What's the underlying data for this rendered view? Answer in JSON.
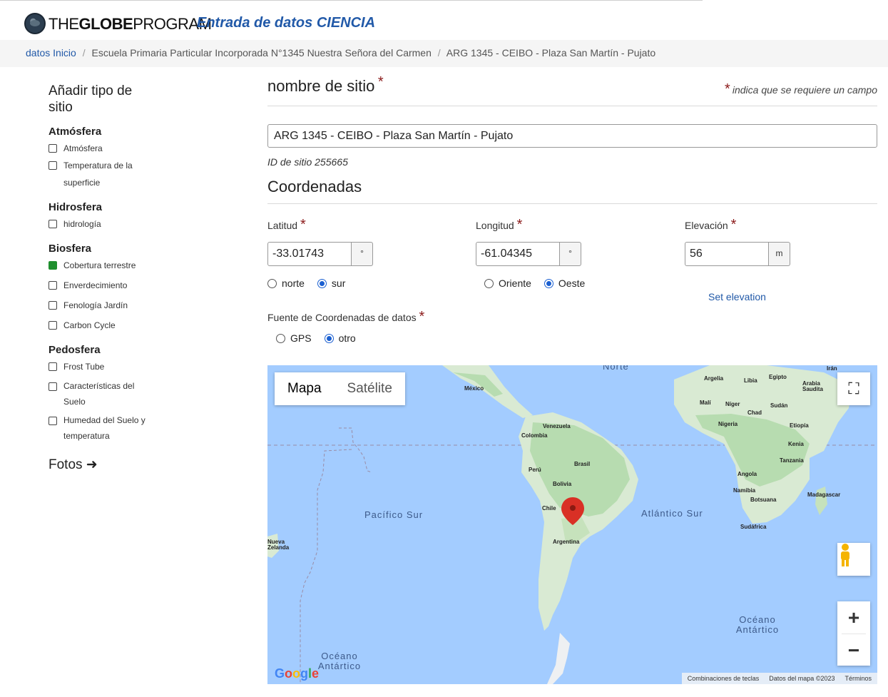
{
  "header": {
    "brand_the": "THE",
    "brand_globe": "GLOBE",
    "brand_program": "PROGRAM",
    "app_title": "Entrada de datos CIENCIA"
  },
  "breadcrumb": {
    "home": "datos Inicio",
    "school": "Escuela Primaria Particular Incorporada N°1345 Nuestra Señora del Carmen",
    "site": "ARG 1345 - CEIBO - Plaza San Martín - Pujato",
    "separator": "/"
  },
  "sidebar": {
    "title": "Añadir tipo de sitio",
    "groups": [
      {
        "name": "Atmósfera",
        "items": [
          "Atmósfera",
          "Temperatura de la superficie"
        ]
      },
      {
        "name": "Hidrosfera",
        "items": [
          "hidrología"
        ]
      },
      {
        "name": "Biosfera",
        "items": [
          "Cobertura terrestre",
          "Enverdecimiento",
          "Fenología Jardín",
          "Carbon Cycle"
        ]
      },
      {
        "name": "Pedosfera",
        "items": [
          "Frost Tube",
          "Características del Suelo",
          "Humedad del Suelo y temperatura"
        ]
      }
    ],
    "fotos": "Fotos ➜"
  },
  "form": {
    "site_name_heading": "nombre de sitio",
    "required_star": "*",
    "required_note": "indica que se requiere un campo",
    "site_name_value": "ARG 1345 - CEIBO - Plaza San Martín - Pujato",
    "site_id": "ID de sitio 255665",
    "coords_heading": "Coordenadas",
    "latitude": {
      "label": "Latitud",
      "value": "-33.01743",
      "unit": "°",
      "options": [
        "norte",
        "sur"
      ],
      "selected": "sur"
    },
    "longitude": {
      "label": "Longitud",
      "value": "-61.04345",
      "unit": "°",
      "options": [
        "Oriente",
        "Oeste"
      ],
      "selected": "Oeste"
    },
    "elevation": {
      "label": "Elevación",
      "value": "56",
      "unit": "m",
      "action": "Set elevation"
    },
    "source": {
      "label": "Fuente de Coordenadas de datos",
      "options": [
        "GPS",
        "otro"
      ],
      "selected": "otro"
    }
  },
  "map": {
    "type_buttons": [
      "Mapa",
      "Satélite"
    ],
    "active_type": "Mapa",
    "ocean_labels": [
      "Pacífico Sur",
      "Atlántico Sur",
      "Océano Antártico",
      "Océano Antártico",
      "Norte"
    ],
    "countries": [
      "México",
      "Venezuela",
      "Colombia",
      "Perú",
      "Brasil",
      "Bolivia",
      "Chile",
      "Argentina",
      "Argelia",
      "Libia",
      "Egipto",
      "Arabia Saudita",
      "Malí",
      "Níger",
      "Chad",
      "Sudán",
      "Nigeria",
      "Etiopía",
      "Kenia",
      "Tanzania",
      "Angola",
      "Namibia",
      "Botsuana",
      "Madagascar",
      "Sudáfrica",
      "Irán",
      "Nueva Zelanda"
    ],
    "zoom_in": "+",
    "zoom_out": "−",
    "footer": [
      "Combinaciones de teclas",
      "Datos del mapa ©2023",
      "Términos"
    ],
    "logo": "Google",
    "colors": {
      "ocean": "#a3ccff",
      "land": "#d9ead3",
      "forest": "#b7dcb0",
      "marker": "#d93025"
    }
  }
}
